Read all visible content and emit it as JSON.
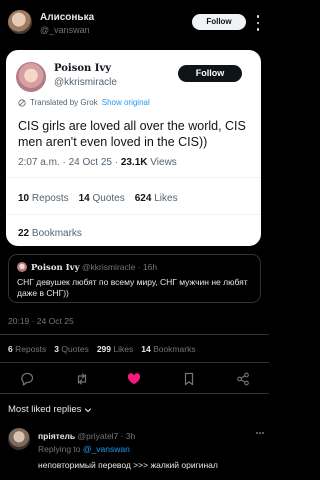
{
  "header": {
    "name": "Алисонька",
    "handle": "@_vanswan",
    "follow_label": "Follow"
  },
  "card": {
    "name": "Poison Ivy",
    "handle": "@kkrismiracle",
    "follow_label": "Follow",
    "translated_by": "Translated by Grok",
    "show_original": "Show original",
    "text": "CIS girls are loved all over the world, CIS men aren't even loved in the CIS))",
    "time": "2:07 a.m. · 24 Oct 25 · ",
    "views_count": "23.1K",
    "views_label": " Views",
    "reposts_count": "10",
    "reposts_label": "Reposts",
    "quotes_count": "14",
    "quotes_label": "Quotes",
    "likes_count": "624",
    "likes_label": "Likes",
    "bookmarks_count": "22",
    "bookmarks_label": "Bookmarks"
  },
  "quote": {
    "name": "Poison Ivy",
    "handle_time": " @kkrismiracle · 16h",
    "text": "СНГ девушек любят по всему миру, СНГ мужчин не любят даже в СНГ))"
  },
  "post": {
    "time": "20:19 · 24 Oct 25"
  },
  "stats": {
    "reposts_count": "6",
    "reposts_label": "Reposts",
    "quotes_count": "3",
    "quotes_label": "Quotes",
    "likes_count": "299",
    "likes_label": "Likes",
    "bookmarks_count": "14",
    "bookmarks_label": "Bookmarks"
  },
  "actions": [
    "reply-icon",
    "repost-icon",
    "like-icon",
    "bookmark-icon",
    "share-icon"
  ],
  "colors": {
    "like": "#f91880",
    "link": "#1d9bf0",
    "muted": "#71767b"
  },
  "replies": {
    "sort_label": "Most liked replies",
    "first": {
      "name": "прiятель",
      "handle_time": " @priyatel7 · 3h",
      "replying_to_label": "Replying to ",
      "replying_to": "@_vanswan",
      "text": "неповторимый перевод >>> жалкий оригинал"
    }
  }
}
